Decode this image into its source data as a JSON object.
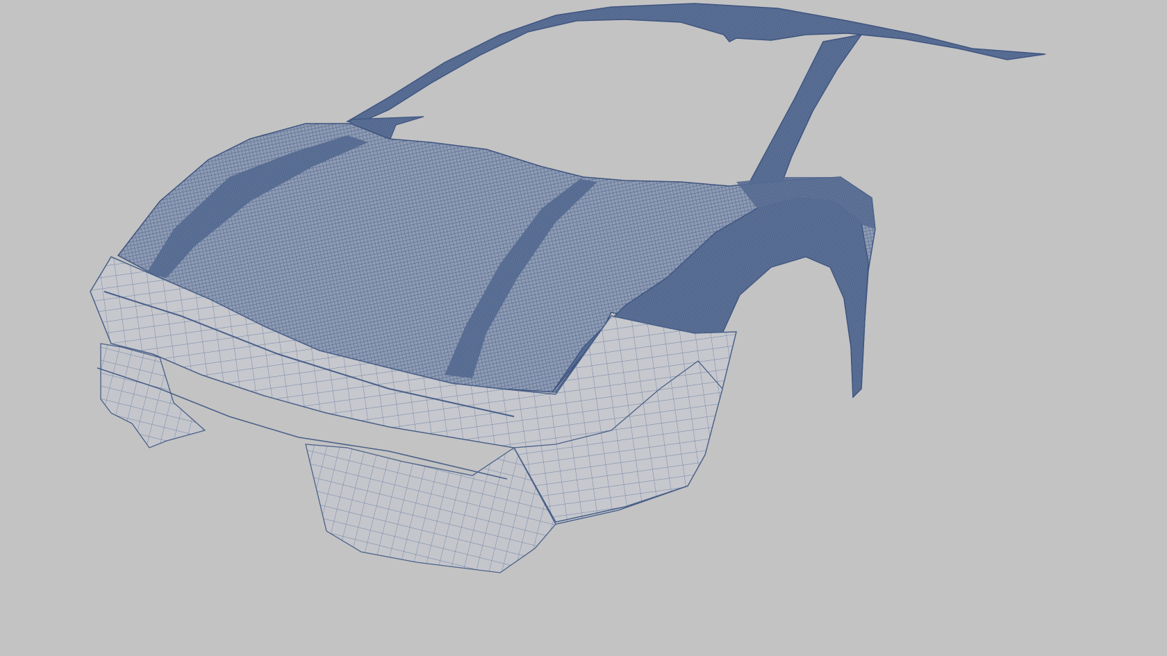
{
  "viewport": {
    "background_color": "#c3c3c3",
    "display_mode": "wireframe",
    "object": "car-body-front-shell",
    "wire_color": "#4a6088",
    "surface_color": "#c9cbd0"
  }
}
